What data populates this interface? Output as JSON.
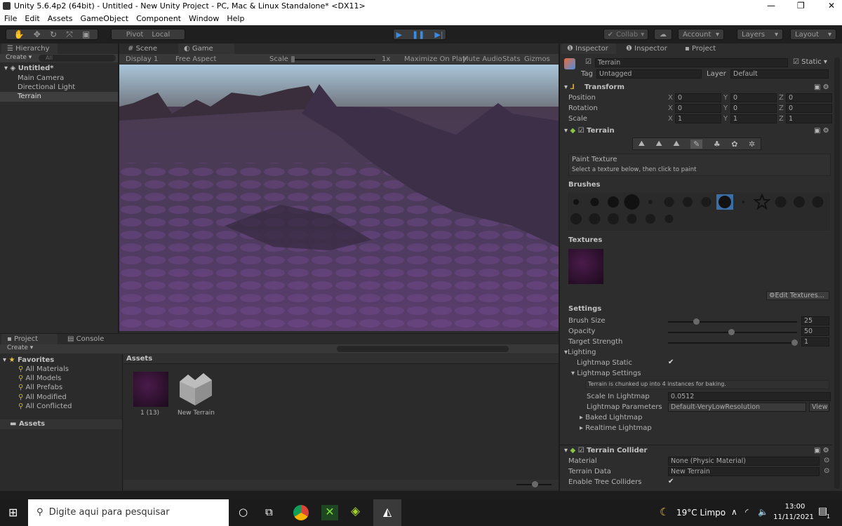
{
  "window": {
    "title": "Unity 5.6.4p2 (64bit) - Untitled - New Unity Project - PC, Mac & Linux Standalone* <DX11>",
    "minimize": "—",
    "maximize": "❐",
    "close": "✕"
  },
  "menu": [
    "File",
    "Edit",
    "Assets",
    "GameObject",
    "Component",
    "Window",
    "Help"
  ],
  "toolbar": {
    "pivot": "Pivot",
    "local": "Local",
    "collab": "Collab",
    "account": "Account",
    "layers": "Layers",
    "layout": "Layout"
  },
  "hierarchy": {
    "tab": "Hierarchy",
    "create": "Create",
    "search_placeholder": "All",
    "scene": "Untitled*",
    "items": [
      "Main Camera",
      "Directional Light",
      "Terrain"
    ]
  },
  "game": {
    "tabs": [
      "Scene",
      "Game"
    ],
    "display": "Display 1",
    "aspect": "Free Aspect",
    "scale_label": "Scale",
    "scale_value": "1x",
    "scale_fraction": 0,
    "options": [
      "Maximize On Play",
      "Mute Audio",
      "Stats",
      "Gizmos"
    ]
  },
  "project": {
    "tabs": [
      "Project",
      "Console"
    ],
    "create": "Create",
    "favorites": "Favorites",
    "fav_items": [
      "All Materials",
      "All Models",
      "All Prefabs",
      "All Modified",
      "All Conflicted"
    ],
    "assets_folder": "Assets",
    "assets_header": "Assets",
    "assets": [
      {
        "name": "1 (13)",
        "type": "texture"
      },
      {
        "name": "New Terrain",
        "type": "terrain"
      }
    ]
  },
  "inspector": {
    "tabs": [
      "Inspector",
      "Inspector",
      "Project"
    ],
    "object_name": "Terrain",
    "static": "Static",
    "tag_label": "Tag",
    "tag": "Untagged",
    "layer_label": "Layer",
    "layer": "Default",
    "transform": {
      "title": "Transform",
      "rows": [
        {
          "label": "Position",
          "x": "0",
          "y": "0",
          "z": "0"
        },
        {
          "label": "Rotation",
          "x": "0",
          "y": "0",
          "z": "0"
        },
        {
          "label": "Scale",
          "x": "1",
          "y": "1",
          "z": "1"
        }
      ]
    },
    "terrain": {
      "title": "Terrain",
      "tool_title": "Paint Texture",
      "tool_hint": "Select a texture below, then click to paint",
      "brushes_label": "Brushes",
      "textures_label": "Textures",
      "edit_textures": "Edit Textures...",
      "settings_label": "Settings",
      "brush_size": {
        "label": "Brush Size",
        "value": "25",
        "fraction": 0.22
      },
      "opacity": {
        "label": "Opacity",
        "value": "50",
        "fraction": 0.5
      },
      "target_strength": {
        "label": "Target Strength",
        "value": "1",
        "fraction": 1.0
      },
      "lighting": "Lighting",
      "lightmap_static": "Lightmap Static",
      "lightmap_settings": "Lightmap Settings",
      "chunk_info": "Terrain is chunked up into 4 instances for baking.",
      "scale_in_lightmap_label": "Scale In Lightmap",
      "scale_in_lightmap": "0.0512",
      "lightmap_params_label": "Lightmap Parameters",
      "lightmap_params": "Default-VeryLowResolution",
      "view": "View",
      "baked": "Baked Lightmap",
      "realtime": "Realtime Lightmap"
    },
    "collider": {
      "title": "Terrain Collider",
      "material_label": "Material",
      "material": "None (Physic Material)",
      "data_label": "Terrain Data",
      "data": "New Terrain",
      "tree_label": "Enable Tree Colliders"
    }
  },
  "taskbar": {
    "search_placeholder": "Digite aqui para pesquisar",
    "weather": "19°C  Limpo",
    "time": "13:00",
    "date": "11/11/2021",
    "notifications": "1"
  }
}
